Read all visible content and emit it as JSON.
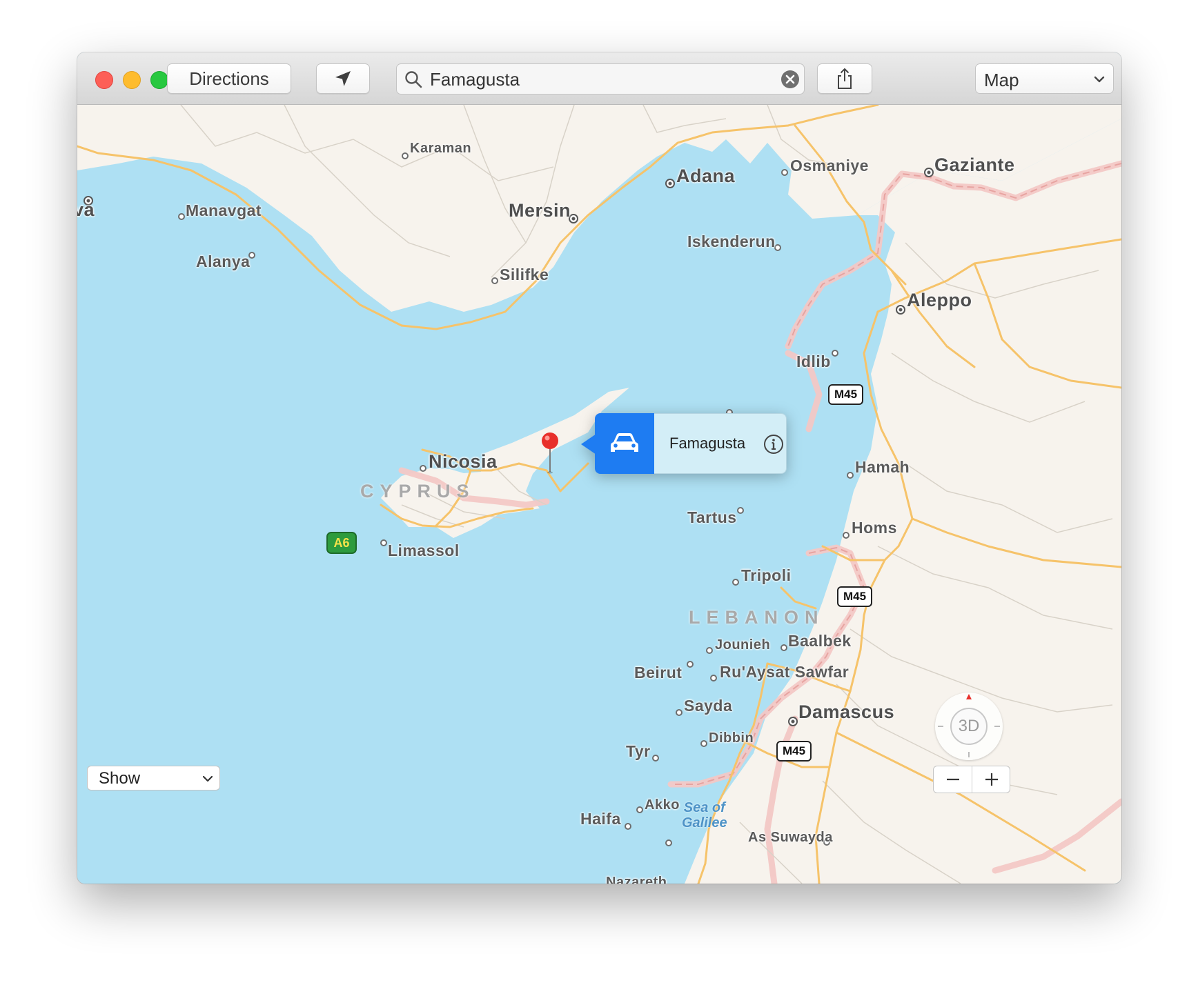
{
  "toolbar": {
    "directions_label": "Directions",
    "search_value": "Famagusta",
    "map_type": "Map"
  },
  "map": {
    "cities": [
      {
        "name": "Karaman"
      },
      {
        "name": "Adana"
      },
      {
        "name": "Osmaniye"
      },
      {
        "name": "Gaziante"
      },
      {
        "name": "va"
      },
      {
        "name": "Manavgat"
      },
      {
        "name": "Mersin"
      },
      {
        "name": "Iskenderun"
      },
      {
        "name": "Alanya"
      },
      {
        "name": "Silifke"
      },
      {
        "name": "Aleppo"
      },
      {
        "name": "Idlib"
      },
      {
        "name": "Nicosia"
      },
      {
        "name": "Hamah"
      },
      {
        "name": "Tartus"
      },
      {
        "name": "Homs"
      },
      {
        "name": "Limassol"
      },
      {
        "name": "Tripoli"
      },
      {
        "name": "Jounieh"
      },
      {
        "name": "Baalbek"
      },
      {
        "name": "Beirut"
      },
      {
        "name": "Ru'Aysat Sawfar"
      },
      {
        "name": "Sayda"
      },
      {
        "name": "Damascus"
      },
      {
        "name": "Dibbin"
      },
      {
        "name": "Tyr"
      },
      {
        "name": "Akko"
      },
      {
        "name": "Haifa"
      },
      {
        "name": "As Suwayda"
      },
      {
        "name": "Nazareth"
      }
    ],
    "countries": [
      "CYPRUS",
      "LEBANON"
    ],
    "water": {
      "line1": "Sea of",
      "line2": "Galilee"
    },
    "shields": {
      "m45": "M45",
      "a6": "A6"
    }
  },
  "callout": {
    "place_name": "Famagusta"
  },
  "bottom": {
    "show_label": "Show",
    "compass_label": "3D"
  },
  "colors": {
    "sea": "#aee0f3",
    "land": "#f7f3ed",
    "road": "#f6c36a",
    "border": "#f3c8c6",
    "pin": "#e8302b",
    "callout_accent": "#1e7cf2"
  }
}
